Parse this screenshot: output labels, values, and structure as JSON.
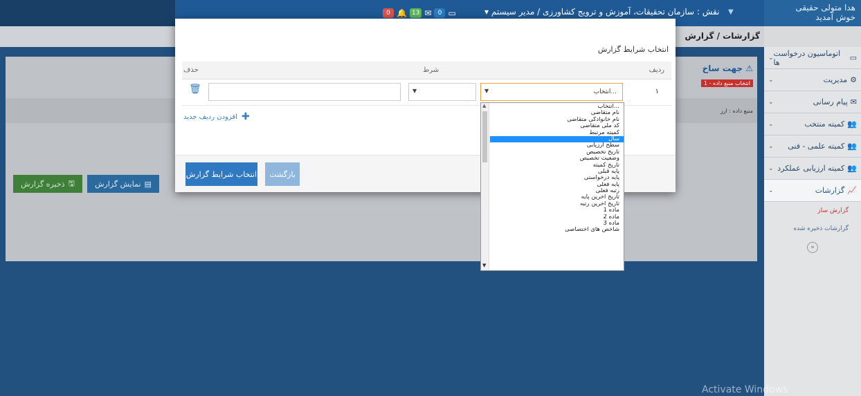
{
  "topbar": {
    "role_text": "نقش : سازمان تحقیقات، آموزش و ترویج کشاورزی / مدیر سیستم",
    "user_name": "هدا متولی حقیقی",
    "welcome": "خوش آمدید",
    "badges": {
      "alerts": "0",
      "messages": "13",
      "tasks": "0"
    }
  },
  "sidebar": {
    "items": [
      {
        "label": "اتوماسیون درخواست ها"
      },
      {
        "label": "مدیریت"
      },
      {
        "label": "پیام رسانی"
      },
      {
        "label": "کمیته منتخب"
      },
      {
        "label": "کمیته علمی - فنی"
      },
      {
        "label": "کمیته ارزیابی عملکرد"
      },
      {
        "label": "گزارشات"
      }
    ],
    "subitems": [
      {
        "label": "گزارش ساز"
      },
      {
        "label": "گزارشات ذخیره شده"
      }
    ]
  },
  "main": {
    "breadcrumb": "گزارشات / گزارش",
    "panel_title": "جهت ساخ",
    "panel_alert": "1 - انتخاب منبع داده",
    "panel_note": "منبع داده : ارز",
    "show_report": "نمایش گزارش",
    "save_report": "ذخیره گزارش"
  },
  "modal": {
    "title": "انتخاب شرایط گزارش",
    "col_radif": "ردیف",
    "col_shart": "شرط",
    "col_hazf": "حذف",
    "row_number": "۱",
    "select_value": "انتخاب...",
    "add_row": "افزودن ردیف جدید",
    "btn_select": "انتخاب شرایط گزارش",
    "btn_back": "بازگشت"
  },
  "dropdown": {
    "options": [
      "انتخاب...",
      "نام متقاضی",
      "نام خانوادگی متقاضی",
      "کد ملی متقاضی",
      "کمیته مرتبط",
      "سال",
      "سطح ارزیابی",
      "تاریخ تخصیص",
      "وضعیت تخصیص",
      "تاریخ کمیته",
      "پایه قبلی",
      "پایه درخواستی",
      "پایه فعلی",
      "رتبه فعلی",
      "تاریخ آخرین پایه",
      "تاریخ آخرین رتبه",
      "ماده 1",
      "ماده 2",
      "ماده 3",
      "شاخص های اختصاصی"
    ],
    "highlighted_index": 5
  },
  "watermark": "Activate Windows",
  "colors": {
    "brand": "#1f5a96",
    "accent": "#2f78c2",
    "highlight": "#1e90ff",
    "danger": "#c9302c",
    "success": "#3f7f3a"
  }
}
